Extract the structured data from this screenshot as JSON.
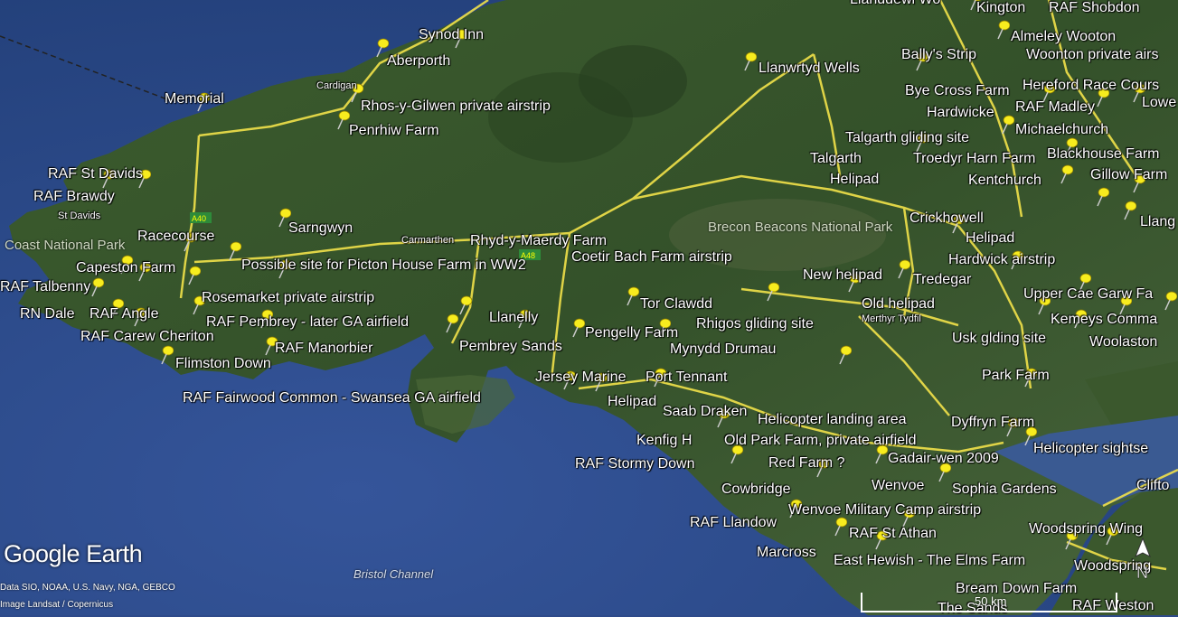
{
  "map_labels": {
    "synod_inn": "Synod Inn",
    "aberporth": "Aberporth",
    "cardigan": "Cardigan",
    "rhos_y_gilwen": "Rhos-y-Gilwen private airstrip",
    "penrhiw_farm": "Penrhiw Farm",
    "memorial": "Memorial",
    "raf_st_davids": "RAF St Davids",
    "raf_brawdy": "RAF Brawdy",
    "st_davids": "St Davids",
    "coast_national_park": "Coast National Park",
    "racecourse": "Racecourse",
    "sarngwyn": "Sarngwyn",
    "capeston_farm": "Capeston Farm",
    "picton_house": "Possible site for Picton House Farm in WW2",
    "raf_talbenny": "RAF Talbenny",
    "rosemarket": "Rosemarket private airstrip",
    "rn_dale": "RN Dale",
    "raf_angle": "RAF Angle",
    "raf_pembrey": "RAF Pembrey - later GA airfield",
    "raf_carew_cheriton": "RAF Carew Cheriton",
    "raf_manorbier": "RAF Manorbier",
    "flimston_down": "Flimston Down",
    "raf_fairwood": "RAF Fairwood Common - Swansea GA airfield",
    "carmarthen": "Carmarthen",
    "rhyd_y_maerdy": "Rhyd-y-Maerdy Farm",
    "coetir_bach": "Coetir Bach Farm airstrip",
    "llanelly": "Llanelly",
    "pembrey_sands": "Pembrey Sands",
    "pengelly_farm": "Pengelly Farm",
    "tor_clawdd": "Tor Clawdd",
    "rhigos": "Rhigos gliding site",
    "mynydd_drumau": "Mynydd Drumau",
    "jersey_marine": "Jersey Marine",
    "port_tennant": "Port Tennant",
    "helipad_swansea": "Helipad",
    "saab_draken": "Saab Draken",
    "kenfig_hill": "Kenfig H",
    "old_park_farm": "Old Park Farm, private airfield",
    "raf_stormy_down": "RAF Stormy Down",
    "red_farm": "Red Farm ?",
    "cowbridge": "Cowbridge",
    "raf_llandow": "RAF Llandow",
    "marcross": "Marcross",
    "wenvoe_military": "Wenvoe Military Camp airstrip",
    "raf_st_athan": "RAF St Athan",
    "east_hewish": "East Hewish - The Elms Farm",
    "llanwrtyd_wells": "Llanwrtyd Wells",
    "brecon_beacons": "Brecon Beacons National Park",
    "talgarth": "Talgarth",
    "helipad_talgarth": "Helipad",
    "talgarth_gliding": "Talgarth gliding site",
    "troedyr_harn": "Troedyr Harn Farm",
    "crickhowell": "Crickhowell",
    "helipad_crickhowell": "Helipad",
    "new_helipad": "New helipad",
    "tredegar": "Tredegar",
    "old_helipad": "Old helipad",
    "merthyr_tydfil": "Merthyr Tydfil",
    "helicopter_landing": "Helicopter landing area",
    "dyffryn_farm": "Dyffryn Farm",
    "gadair_wen": "Gadair-wen 2009",
    "wenvoe": "Wenvoe",
    "sophia_gardens": "Sophia Gardens",
    "helicopter_sightseeing": "Helicopter sightse",
    "park_farm": "Park Farm",
    "usk_gliding": "Usk glding site",
    "kemeys_commander": "Kemeys Comma",
    "woolaston": "Woolaston",
    "upper_cae_garw": "Upper Cae Garw Fa",
    "hardwick_airstrip": "Hardwick airstrip",
    "kentchurch": "Kentchurch",
    "blackhouse_farm": "Blackhouse Farm",
    "gillow_farm": "Gillow Farm",
    "llang": "Llang",
    "michaelchurch": "Michaelchurch",
    "raf_madley": "RAF Madley",
    "hardwicke": "Hardwicke",
    "bye_cross_farm": "Bye Cross Farm",
    "hereford_race": "Hereford Race Cours",
    "lower": "Lowe",
    "ballys_strip": "Bally's Strip",
    "almeley_wooton": "Almeley Wooton",
    "woonton": "Woonton private airs",
    "kington": "Kington",
    "raf_shobdon": "RAF Shobdon",
    "llanddewi_partial": "Llanddewi Wo",
    "woodspring_wing": "Woodspring Wing",
    "woodspring": "Woodspring",
    "clifton": "Clifto",
    "bream_down_farm": "Bream Down Farm",
    "the_sands": "The Sands",
    "raf_weston": "RAF Weston",
    "bristol_channel": "Bristol Channel"
  },
  "branding": {
    "logo": "Google Earth",
    "credit_line_1": "Data SIO, NOAA, U.S. Navy, NGA, GEBCO",
    "credit_line_2": "Image Landsat / Copernicus"
  },
  "scale": {
    "label": "50 km"
  },
  "compass": {
    "label": "N"
  },
  "road_shields": {
    "a40": "A40",
    "a48": "A48"
  },
  "colors": {
    "sea": "#2e4a8a",
    "land": "#3d5a2e",
    "road": "#f2e24a",
    "pin": "#f7ec1e"
  }
}
